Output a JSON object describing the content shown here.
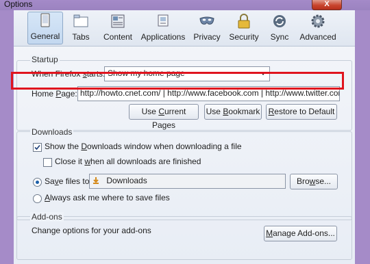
{
  "window": {
    "title": "Options",
    "close_glyph": "X"
  },
  "toolbar": {
    "tabs": [
      {
        "label": "General",
        "icon": "general-icon",
        "selected": true
      },
      {
        "label": "Tabs",
        "icon": "tabs-icon"
      },
      {
        "label": "Content",
        "icon": "content-icon"
      },
      {
        "label": "Applications",
        "icon": "applications-icon"
      },
      {
        "label": "Privacy",
        "icon": "privacy-mask-icon"
      },
      {
        "label": "Security",
        "icon": "padlock-icon"
      },
      {
        "label": "Sync",
        "icon": "sync-icon"
      },
      {
        "label": "Advanced",
        "icon": "gear-icon"
      }
    ]
  },
  "startup": {
    "group_label": "Startup",
    "when_label_pre": "When Firefox ",
    "when_label_u": "s",
    "when_label_post": "tarts:",
    "when_value": "Show my home page",
    "home_label_pre": "Home ",
    "home_label_u": "P",
    "home_label_post": "age:",
    "home_value": "http://howto.cnet.com/ | http://www.facebook.com | http://www.twitter.com",
    "btn_current_pre": "Use ",
    "btn_current_u": "C",
    "btn_current_post": "urrent Pages",
    "btn_bookmark_pre": "Use ",
    "btn_bookmark_u": "B",
    "btn_bookmark_post": "ookmark",
    "btn_restore_u": "R",
    "btn_restore_post": "estore to Default"
  },
  "downloads": {
    "group_label": "Downloads",
    "show_pre": "Show the ",
    "show_u": "D",
    "show_post": "ownloads window when downloading a file",
    "show_checked": true,
    "close_pre": "Close it ",
    "close_u": "w",
    "close_post": "hen all downloads are finished",
    "close_checked": false,
    "save_pre": "Sa",
    "save_u": "v",
    "save_post": "e files to",
    "save_folder": "Downloads",
    "browse_pre": "Bro",
    "browse_u": "w",
    "browse_post": "se...",
    "ask_u": "A",
    "ask_post": "lways ask me where to save files"
  },
  "addons": {
    "group_label": "Add-ons",
    "desc": "Change options for your add-ons",
    "manage_u": "M",
    "manage_post": "anage Add-ons..."
  },
  "colors": {
    "highlight": "#e0141e",
    "frame": "#a58bc8"
  }
}
